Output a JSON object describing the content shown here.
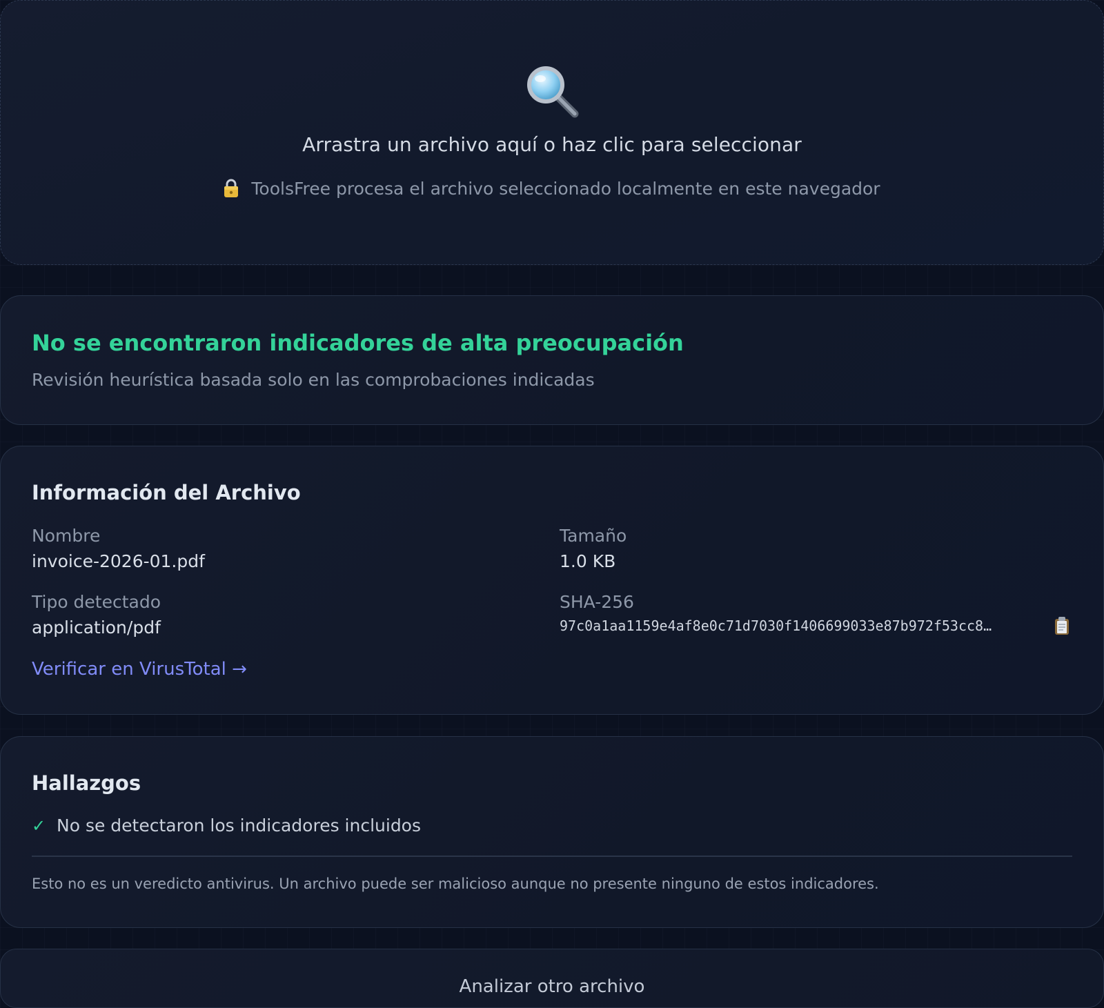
{
  "dropzone": {
    "icon": "magnifier-icon",
    "title": "Arrastra un archivo aquí o haz clic para seleccionar",
    "privacy_icon": "lock-icon",
    "privacy_text": "ToolsFree procesa el archivo seleccionado localmente en este navegador"
  },
  "verdict": {
    "title": "No se encontraron indicadores de alta preocupación",
    "subtitle": "Revisión heurística basada solo en las comprobaciones indicadas",
    "color": "#34d399"
  },
  "file_info": {
    "title": "Información del Archivo",
    "name_label": "Nombre",
    "name_value": "invoice-2026-01.pdf",
    "size_label": "Tamaño",
    "size_value": "1.0 KB",
    "type_label": "Tipo detectado",
    "type_value": "application/pdf",
    "hash_label": "SHA-256",
    "hash_value": "97c0a1aa1159e4af8e0c71d7030f1406699033e87b972f53cc8…",
    "copy_icon": "clipboard-icon",
    "virustotal_link": "Verificar en VirusTotal →",
    "link_color": "#818cf8"
  },
  "findings": {
    "title": "Hallazgos",
    "items": [
      {
        "icon": "check-icon",
        "text": "No se detectaron los indicadores incluidos"
      }
    ],
    "disclaimer": "Esto no es un veredicto antivirus. Un archivo puede ser malicioso aunque no presente ninguno de estos indicadores."
  },
  "actions": {
    "analyze_another": "Analizar otro archivo"
  }
}
